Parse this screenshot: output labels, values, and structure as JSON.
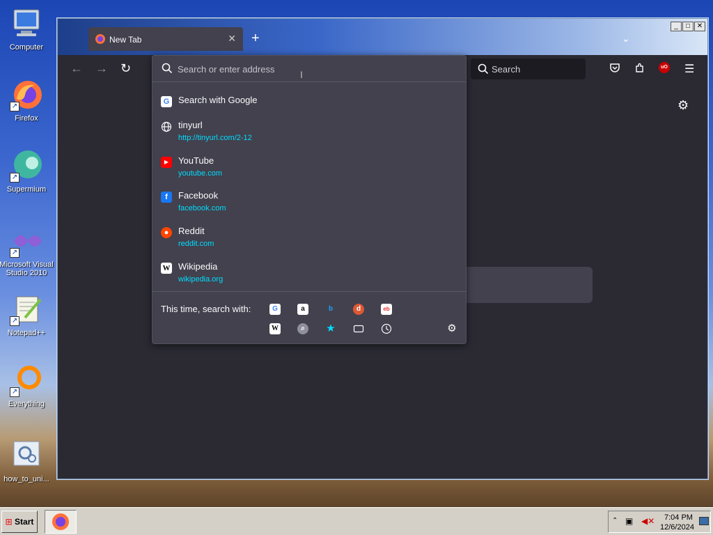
{
  "desktop": {
    "icons": [
      {
        "label": "Computer"
      },
      {
        "label": "Firefox"
      },
      {
        "label": "Supermium"
      },
      {
        "label": "Microsoft Visual Studio 2010"
      },
      {
        "label": "Notepad++"
      },
      {
        "label": "Everything"
      },
      {
        "label": "how_to_uni..."
      }
    ]
  },
  "browser": {
    "tab": {
      "title": "New Tab"
    },
    "search": {
      "placeholder": "Search"
    },
    "ublock_badge": "uO"
  },
  "urlbar": {
    "placeholder": "Search or enter address",
    "results": [
      {
        "title": "Search with Google",
        "url": "",
        "icon": "google-icon"
      },
      {
        "title": "tinyurl",
        "url": "http://tinyurl.com/2-12",
        "icon": "globe-icon"
      },
      {
        "title": "YouTube",
        "url": "youtube.com",
        "icon": "youtube-icon"
      },
      {
        "title": "Facebook",
        "url": "facebook.com",
        "icon": "facebook-icon"
      },
      {
        "title": "Reddit",
        "url": "reddit.com",
        "icon": "reddit-icon"
      },
      {
        "title": "Wikipedia",
        "url": "wikipedia.org",
        "icon": "wikipedia-icon"
      }
    ],
    "one_off_label": "This time, search with:",
    "engines": [
      "google-icon",
      "amazon-icon",
      "bing-icon",
      "duckduckgo-icon",
      "ebay-icon",
      "wikipedia-icon",
      "search-icon",
      "bookmarks-star-icon",
      "tabs-icon",
      "history-icon"
    ]
  },
  "taskbar": {
    "start_label": "Start",
    "clock_time": "7:04 PM",
    "clock_date": "12/6/2024"
  },
  "colors": {
    "accent_url": "#00ddff",
    "popup_bg": "#42414d",
    "toolbar_bg": "#2b2a33"
  }
}
